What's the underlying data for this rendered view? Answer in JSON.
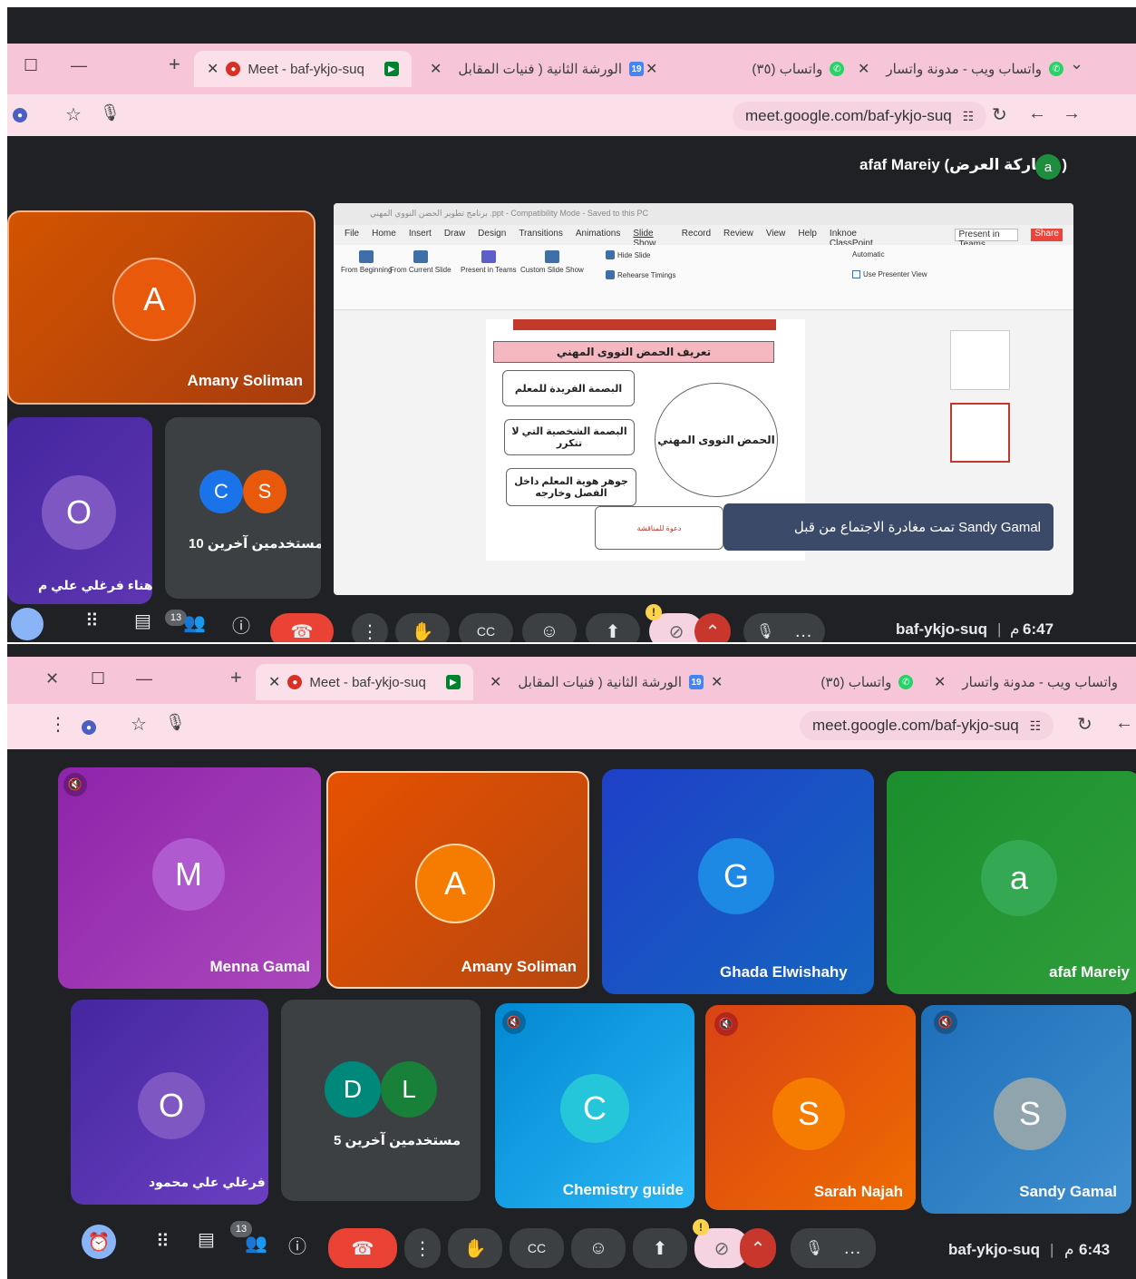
{
  "meeting": {
    "code": "baf-ykjo-suq",
    "url": "meet.google.com/baf-ykjo-suq",
    "people_count": "13"
  },
  "tabs": {
    "meet": "Meet - baf-ykjo-suq",
    "workshop": "الورشة الثانية ( فنيات المقابل",
    "whatsapp_count": "(٣٥) واتساب",
    "whatsapp_web": "واتساب ويب - مدونة واتسار",
    "calendar_day": "19",
    "new_tab": "+"
  },
  "shot1": {
    "time": "6:47",
    "ampm": "م",
    "presenter_label": "afaf Mareiy (مشاركة العرض)",
    "presenter_initial": "a",
    "tiles": [
      {
        "name": "Amany Soliman",
        "initial": "A"
      },
      {
        "name": "هناء فرغلي علي م...",
        "initial": "O"
      },
      {
        "name": "10 مستخدمين آخرين",
        "initials": [
          "C",
          "S"
        ]
      }
    ],
    "slide": {
      "ppt_title": "برنامج تطوير الحضن النووي المهني .ppt - Compatibility Mode - Saved to this PC",
      "menu": [
        "File",
        "Home",
        "Insert",
        "Draw",
        "Design",
        "Transitions",
        "Animations",
        "Slide Show",
        "Record",
        "Review",
        "View",
        "Help",
        "Inknoe ClassPoint"
      ],
      "ribbon": [
        "From Beginning",
        "From Current Slide",
        "Present in Teams",
        "Custom Slide Show",
        "Hide Slide",
        "Rehearse Timings",
        "Automatic",
        "Use Presenter View"
      ],
      "present_in_teams": "Present in Teams",
      "share": "Share",
      "heading": "تعريف الحمض النووى المهني",
      "boxes": [
        "البصمة الفريدة للمعلم",
        "البصمة الشخصية التي لا تتكرر",
        "جوهر هوية المعلم داخل الفصل وخارجه"
      ],
      "circle": "الحمض النووى المهني",
      "invite": "دعوة للمناقشة"
    },
    "toast": "تمت مغادرة الاجتماع من قبل Sandy Gamal"
  },
  "shot2": {
    "time": "6:43",
    "ampm": "م",
    "tiles": [
      {
        "name": "Menna Gamal",
        "initial": "M"
      },
      {
        "name": "Amany Soliman",
        "initial": "A"
      },
      {
        "name": "Ghada Elwishahy",
        "initial": "G"
      },
      {
        "name": "afaf Mareiy",
        "initial": "a"
      },
      {
        "name": "هناء فرغلي علي محمود",
        "initial": "O"
      },
      {
        "name": "5 مستخدمين آخرين",
        "initials": [
          "D",
          "L"
        ]
      },
      {
        "name": "Chemistry guide",
        "initial": "C"
      },
      {
        "name": "Sarah Najah",
        "initial": "S"
      },
      {
        "name": "Sandy Gamal",
        "initial": "S"
      }
    ]
  },
  "icons": {
    "close": "✕",
    "minimize": "—",
    "maximize": "☐",
    "chevron": "⌄",
    "star": "☆",
    "mic": "🎙",
    "reload": "↻",
    "back": "←",
    "forward": "→",
    "more": "⋮"
  },
  "colors": {
    "tab_bar": "#f6c6d8",
    "end_call": "#ea4335",
    "meet_bg": "#202124",
    "toast": "#3c4a6a"
  }
}
